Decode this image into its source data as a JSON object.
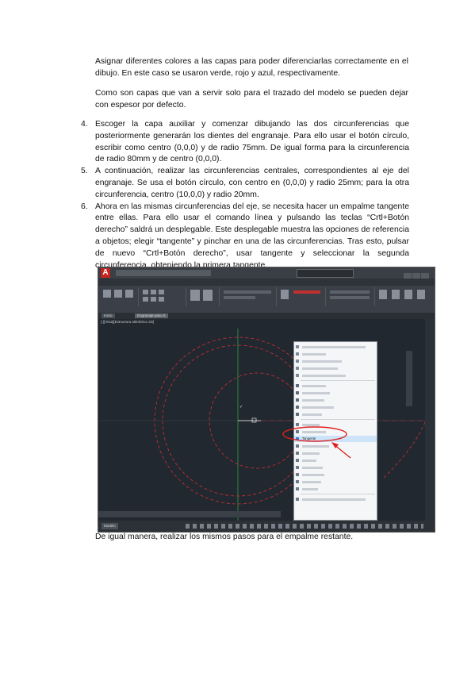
{
  "document": {
    "para1": "Asignar diferentes colores a las capas para poder diferenciarlas correctamente en el dibujo. En este caso se usaron verde, rojo y azul, respectivamente.",
    "para2": "Como son capas que van a servir solo para el trazado del modelo se pueden dejar con espesor por defecto.",
    "steps": [
      {
        "num": "4.",
        "text": "Escoger la capa auxiliar y comenzar dibujando las dos circunferencias que posteriormente generarán los dientes del engranaje. Para ello usar el botón círculo, escribir como centro (0,0,0) y de radio 75mm. De igual forma para la circunferencia de radio 80mm y de centro (0,0,0)."
      },
      {
        "num": "5.",
        "text": "A continuación, realizar las circunferencias centrales, correspondientes al eje del engranaje. Se usa el botón círculo, con centro en (0,0,0) y radio 25mm; para la otra circunferencia, centro (10,0,0) y radio 20mm."
      },
      {
        "num": "6.",
        "text": "Ahora en las mismas circunferencias del eje, se necesita hacer un empalme tangente entre ellas. Para ello usar el comando línea y pulsando las teclas “Crtl+Botón derecho” saldrá un desplegable. Este desplegable muestra las opciones de referencia a objetos; elegir “tangente” y pinchar en una de las circunferencias. Tras esto, pulsar de nuevo “Crtl+Botón derecho”, usar tangente y seleccionar la segunda circunferencia, obteniendo la primera tangente."
      }
    ],
    "after_image": "De igual manera, realizar los mismos pasos para el empalme restante."
  },
  "screenshot": {
    "app_logo": "A",
    "canvas_label": "[-][Vista][Estructura alámbrica 2D]",
    "doc_tabs": [
      "Inicio",
      "Engranaje-paso 6"
    ],
    "model_tab": "Modelo",
    "tangent_item_label": "Tangente",
    "accent_circle_color": "#e02020",
    "annotation_color": "#e02020",
    "layer_line_color": "#d03030",
    "axis_y_color": "#2fa04a"
  }
}
